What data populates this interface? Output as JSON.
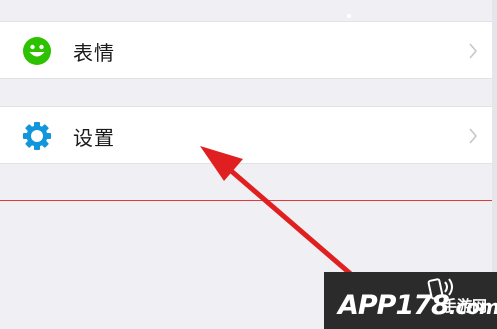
{
  "menu": {
    "items": [
      {
        "label": "表情",
        "icon": "smiley-icon",
        "icon_color": "#2dc100"
      },
      {
        "label": "设置",
        "icon": "gear-icon",
        "icon_color": "#1296db"
      }
    ]
  },
  "annotation": {
    "arrow_color": "#e02020"
  },
  "watermark": {
    "brand": "APP178",
    "suffix": ".com",
    "sub_label": "手游网"
  }
}
